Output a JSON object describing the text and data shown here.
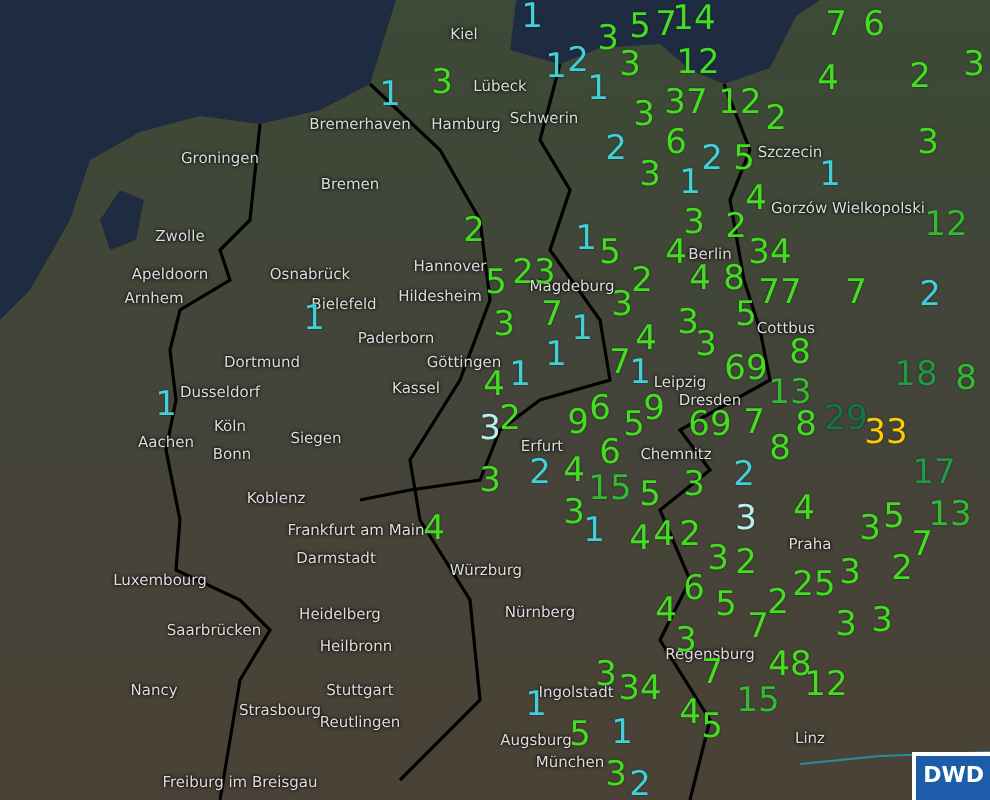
{
  "map": {
    "cities": [
      {
        "name": "Kiel"
      },
      {
        "name": "Lübeck"
      },
      {
        "name": "Hamburg"
      },
      {
        "name": "Schwerin"
      },
      {
        "name": "Bremerhaven"
      },
      {
        "name": "Bremen"
      },
      {
        "name": "Groningen"
      },
      {
        "name": "Zwolle"
      },
      {
        "name": "Apeldoorn"
      },
      {
        "name": "Arnhem"
      },
      {
        "name": "Osnabrück"
      },
      {
        "name": "Hannover"
      },
      {
        "name": "Hildesheim"
      },
      {
        "name": "Bielefeld"
      },
      {
        "name": "Magdeburg"
      },
      {
        "name": "Szczecin"
      },
      {
        "name": "Gorzów Wielkopolski"
      },
      {
        "name": "Berlin"
      },
      {
        "name": "Dortmund"
      },
      {
        "name": "Paderborn"
      },
      {
        "name": "Göttingen"
      },
      {
        "name": "Kassel"
      },
      {
        "name": "Cottbus"
      },
      {
        "name": "Leipzig"
      },
      {
        "name": "Dusseldorf"
      },
      {
        "name": "Dresden"
      },
      {
        "name": "Köln"
      },
      {
        "name": "Aachen"
      },
      {
        "name": "Bonn"
      },
      {
        "name": "Siegen"
      },
      {
        "name": "Erfurt"
      },
      {
        "name": "Chemnitz"
      },
      {
        "name": "Koblenz"
      },
      {
        "name": "Frankfurt am Main"
      },
      {
        "name": "Darmstadt"
      },
      {
        "name": "Würzburg"
      },
      {
        "name": "Praha"
      },
      {
        "name": "Luxembourg"
      },
      {
        "name": "Nürnberg"
      },
      {
        "name": "Heidelberg"
      },
      {
        "name": "Saarbrücken"
      },
      {
        "name": "Heilbronn"
      },
      {
        "name": "Regensburg"
      },
      {
        "name": "Nancy"
      },
      {
        "name": "Stuttgart"
      },
      {
        "name": "Strasbourg"
      },
      {
        "name": "Ingolstadt"
      },
      {
        "name": "Reutlingen"
      },
      {
        "name": "Augsburg"
      },
      {
        "name": "München"
      },
      {
        "name": "Freiburg im Breisgau"
      },
      {
        "name": "Linz"
      }
    ],
    "strike_counts": [
      {
        "value": "1",
        "color": "#40d0d8"
      },
      {
        "value": "3",
        "color": "#44dd22"
      },
      {
        "value": "5",
        "color": "#44dd22"
      },
      {
        "value": "7",
        "color": "#44dd22"
      },
      {
        "value": "14",
        "color": "#44dd22"
      },
      {
        "value": "7",
        "color": "#44dd22"
      },
      {
        "value": "6",
        "color": "#44dd22"
      },
      {
        "value": "1",
        "color": "#40d0d8"
      },
      {
        "value": "3",
        "color": "#44dd22"
      },
      {
        "value": "1",
        "color": "#40d0d8"
      },
      {
        "value": "2",
        "color": "#40d0d8"
      },
      {
        "value": "1",
        "color": "#40d0d8"
      },
      {
        "value": "3",
        "color": "#44dd22"
      },
      {
        "value": "12",
        "color": "#44dd22"
      },
      {
        "value": "4",
        "color": "#44dd22"
      },
      {
        "value": "2",
        "color": "#44dd22"
      },
      {
        "value": "3",
        "color": "#44dd22"
      },
      {
        "value": "3",
        "color": "#44dd22"
      },
      {
        "value": "37",
        "color": "#44dd22"
      },
      {
        "value": "12",
        "color": "#44dd22"
      },
      {
        "value": "2",
        "color": "#44dd22"
      },
      {
        "value": "2",
        "color": "#40d0d8"
      },
      {
        "value": "6",
        "color": "#44dd22"
      },
      {
        "value": "2",
        "color": "#40d0d8"
      },
      {
        "value": "5",
        "color": "#44dd22"
      },
      {
        "value": "3",
        "color": "#44dd22"
      },
      {
        "value": "3",
        "color": "#44dd22"
      },
      {
        "value": "1",
        "color": "#40d0d8"
      },
      {
        "value": "4",
        "color": "#44dd22"
      },
      {
        "value": "1",
        "color": "#40d0d8"
      },
      {
        "value": "2",
        "color": "#44dd22"
      },
      {
        "value": "1",
        "color": "#40d0d8"
      },
      {
        "value": "5",
        "color": "#44dd22"
      },
      {
        "value": "4",
        "color": "#44dd22"
      },
      {
        "value": "3",
        "color": "#44dd22"
      },
      {
        "value": "2",
        "color": "#44dd22"
      },
      {
        "value": "34",
        "color": "#44dd22"
      },
      {
        "value": "12",
        "color": "#33bb33"
      },
      {
        "value": "5",
        "color": "#44dd22"
      },
      {
        "value": "23",
        "color": "#44dd22"
      },
      {
        "value": "3",
        "color": "#44dd22"
      },
      {
        "value": "2",
        "color": "#44dd22"
      },
      {
        "value": "4",
        "color": "#44dd22"
      },
      {
        "value": "8",
        "color": "#44dd22"
      },
      {
        "value": "77",
        "color": "#44dd22"
      },
      {
        "value": "7",
        "color": "#44dd22"
      },
      {
        "value": "2",
        "color": "#40d0d8"
      },
      {
        "value": "1",
        "color": "#40d0d8"
      },
      {
        "value": "3",
        "color": "#44dd22"
      },
      {
        "value": "7",
        "color": "#44dd22"
      },
      {
        "value": "1",
        "color": "#40d0d8"
      },
      {
        "value": "1",
        "color": "#40d0d8"
      },
      {
        "value": "4",
        "color": "#44dd22"
      },
      {
        "value": "3",
        "color": "#44dd22"
      },
      {
        "value": "3",
        "color": "#44dd22"
      },
      {
        "value": "5",
        "color": "#44dd22"
      },
      {
        "value": "8",
        "color": "#44dd22"
      },
      {
        "value": "4",
        "color": "#44dd22"
      },
      {
        "value": "1",
        "color": "#40d0d8"
      },
      {
        "value": "7",
        "color": "#44dd22"
      },
      {
        "value": "1",
        "color": "#40d0d8"
      },
      {
        "value": "69",
        "color": "#44dd22"
      },
      {
        "value": "13",
        "color": "#33bb33"
      },
      {
        "value": "18",
        "color": "#229944"
      },
      {
        "value": "8",
        "color": "#33bb33"
      },
      {
        "value": "1",
        "color": "#40d0d8"
      },
      {
        "value": "3",
        "color": "#b8f0f0"
      },
      {
        "value": "2",
        "color": "#44dd22"
      },
      {
        "value": "9",
        "color": "#44dd22"
      },
      {
        "value": "6",
        "color": "#44dd22"
      },
      {
        "value": "5",
        "color": "#44dd22"
      },
      {
        "value": "9",
        "color": "#44dd22"
      },
      {
        "value": "69",
        "color": "#44dd22"
      },
      {
        "value": "7",
        "color": "#44dd22"
      },
      {
        "value": "8",
        "color": "#44dd22"
      },
      {
        "value": "29",
        "color": "#117744"
      },
      {
        "value": "33",
        "color": "#ffcc00"
      },
      {
        "value": "3",
        "color": "#44dd22"
      },
      {
        "value": "2",
        "color": "#40d0d8"
      },
      {
        "value": "4",
        "color": "#44dd22"
      },
      {
        "value": "6",
        "color": "#44dd22"
      },
      {
        "value": "15",
        "color": "#33bb33"
      },
      {
        "value": "5",
        "color": "#44dd22"
      },
      {
        "value": "3",
        "color": "#44dd22"
      },
      {
        "value": "2",
        "color": "#40d0d8"
      },
      {
        "value": "8",
        "color": "#44dd22"
      },
      {
        "value": "17",
        "color": "#229944"
      },
      {
        "value": "4",
        "color": "#44dd22"
      },
      {
        "value": "3",
        "color": "#44dd22"
      },
      {
        "value": "1",
        "color": "#40d0d8"
      },
      {
        "value": "4",
        "color": "#44dd22"
      },
      {
        "value": "4",
        "color": "#44dd22"
      },
      {
        "value": "2",
        "color": "#44dd22"
      },
      {
        "value": "3",
        "color": "#b8f0f0"
      },
      {
        "value": "4",
        "color": "#44dd22"
      },
      {
        "value": "3",
        "color": "#44dd22"
      },
      {
        "value": "5",
        "color": "#44dd22"
      },
      {
        "value": "7",
        "color": "#44dd22"
      },
      {
        "value": "13",
        "color": "#33bb33"
      },
      {
        "value": "6",
        "color": "#44dd22"
      },
      {
        "value": "3",
        "color": "#44dd22"
      },
      {
        "value": "2",
        "color": "#44dd22"
      },
      {
        "value": "25",
        "color": "#44dd22"
      },
      {
        "value": "3",
        "color": "#44dd22"
      },
      {
        "value": "2",
        "color": "#44dd22"
      },
      {
        "value": "4",
        "color": "#44dd22"
      },
      {
        "value": "3",
        "color": "#44dd22"
      },
      {
        "value": "5",
        "color": "#44dd22"
      },
      {
        "value": "7",
        "color": "#44dd22"
      },
      {
        "value": "2",
        "color": "#44dd22"
      },
      {
        "value": "3",
        "color": "#44dd22"
      },
      {
        "value": "3",
        "color": "#44dd22"
      },
      {
        "value": "1",
        "color": "#40d0d8"
      },
      {
        "value": "3",
        "color": "#44dd22"
      },
      {
        "value": "34",
        "color": "#44dd22"
      },
      {
        "value": "7",
        "color": "#44dd22"
      },
      {
        "value": "48",
        "color": "#44dd22"
      },
      {
        "value": "15",
        "color": "#33bb33"
      },
      {
        "value": "12",
        "color": "#44dd22"
      },
      {
        "value": "5",
        "color": "#44dd22"
      },
      {
        "value": "1",
        "color": "#40d0d8"
      },
      {
        "value": "4",
        "color": "#44dd22"
      },
      {
        "value": "5",
        "color": "#44dd22"
      },
      {
        "value": "3",
        "color": "#44dd22"
      },
      {
        "value": "2",
        "color": "#40d0d8"
      }
    ]
  },
  "logo": {
    "text": "DWD"
  }
}
